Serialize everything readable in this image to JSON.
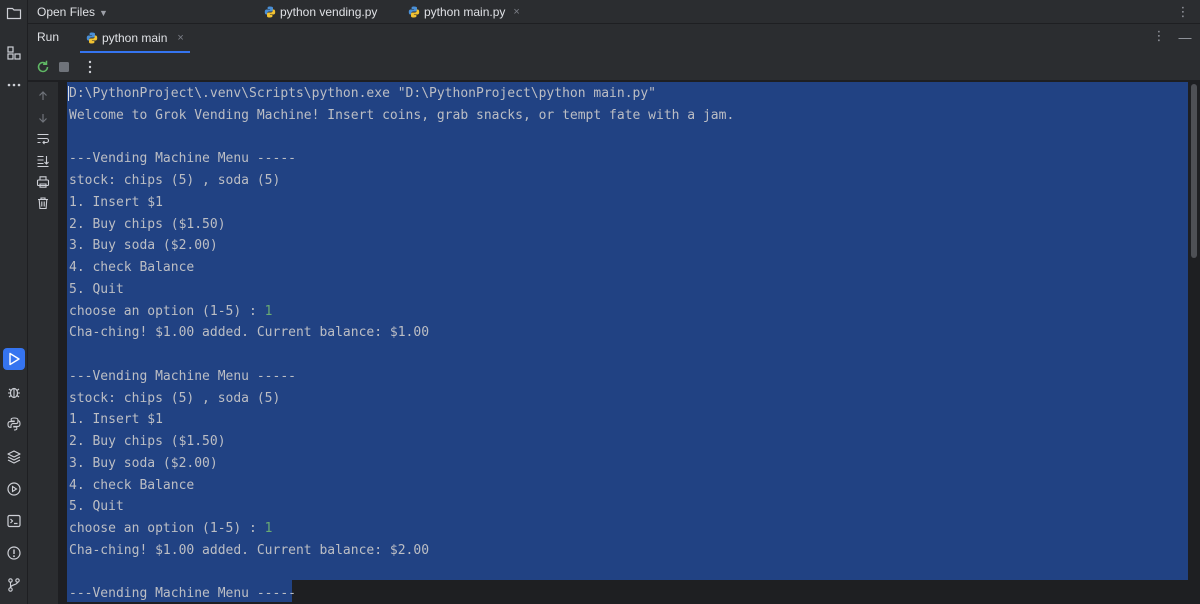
{
  "top_bar": {
    "open_files_label": "Open Files",
    "tabs": [
      {
        "label": "python vending.py",
        "icon": "python-icon",
        "closable": false
      },
      {
        "label": "python main.py",
        "icon": "python-icon",
        "closable": true
      }
    ],
    "close_glyph": "×",
    "more_glyph": "⋮"
  },
  "run_window": {
    "title": "Run",
    "tab": {
      "label": "python main",
      "icon": "python-icon",
      "close_glyph": "×"
    },
    "minimize_glyph": "—",
    "more_glyph": "⋮"
  },
  "console": {
    "lines": [
      {
        "text": "D:\\PythonProject\\.venv\\Scripts\\python.exe \"D:\\PythonProject\\python main.py\""
      },
      {
        "text": "Welcome to Grok Vending Machine! Insert coins, grab snacks, or tempt fate with a jam."
      },
      {
        "text": ""
      },
      {
        "text": "---Vending Machine Menu -----"
      },
      {
        "text": "stock: chips (5) , soda (5)"
      },
      {
        "text": "1. Insert $1"
      },
      {
        "text": "2. Buy chips ($1.50)"
      },
      {
        "text": "3. Buy soda ($2.00)"
      },
      {
        "text": "4. check Balance"
      },
      {
        "text": "5. Quit"
      },
      {
        "text": "choose an option (1-5) : ",
        "input": "1"
      },
      {
        "text": "Cha-ching! $1.00 added. Current balance: $1.00"
      },
      {
        "text": ""
      },
      {
        "text": "---Vending Machine Menu -----"
      },
      {
        "text": "stock: chips (5) , soda (5)"
      },
      {
        "text": "1. Insert $1"
      },
      {
        "text": "2. Buy chips ($1.50)"
      },
      {
        "text": "3. Buy soda ($2.00)"
      },
      {
        "text": "4. check Balance"
      },
      {
        "text": "5. Quit"
      },
      {
        "text": "choose an option (1-5) : ",
        "input": "1"
      },
      {
        "text": "Cha-ching! $1.00 added. Current balance: $2.00"
      },
      {
        "text": ""
      },
      {
        "text": "---Vending Machine Menu -----"
      }
    ]
  },
  "icons": {
    "left_strip": [
      "folder-icon",
      "structure-icon",
      "more-icon",
      "run-icon",
      "debug-icon",
      "python-console-icon",
      "layers-icon",
      "services-icon",
      "terminal-icon",
      "problems-icon",
      "git-icon"
    ],
    "toolbar": [
      "rerun-icon",
      "stop-icon",
      "more-icon"
    ],
    "gutter": [
      "arrow-up-icon",
      "arrow-down-icon",
      "soft-wrap-icon",
      "scroll-to-end-icon",
      "print-icon",
      "trash-icon"
    ]
  },
  "colors": {
    "accent": "#3574f0",
    "selection": "#214283",
    "user_input": "#6aab73",
    "background": "#1e1f22",
    "panel": "#2b2d30"
  }
}
